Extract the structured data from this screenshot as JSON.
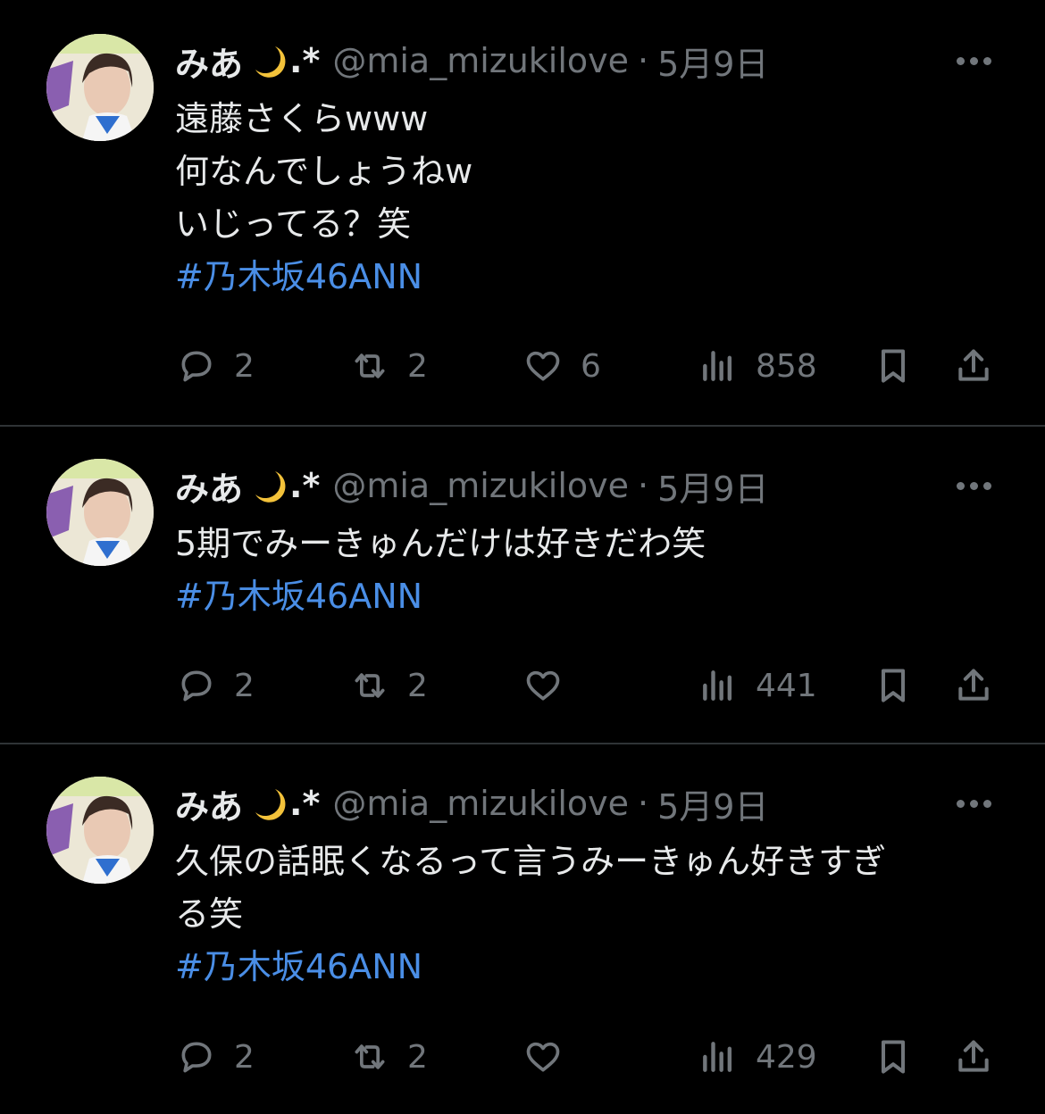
{
  "tweets": [
    {
      "author": {
        "name": "みあ",
        "suffix": ".*",
        "handle": "@mia_mizukilove",
        "separator": "·",
        "date": "5月9日"
      },
      "lines": [
        "遠藤さくらwww",
        "何なんでしょうねw",
        "いじってる？笑"
      ],
      "hashtag": "#乃木坂46ANN",
      "stats": {
        "replies": "2",
        "retweets": "2",
        "likes": "6",
        "views": "858"
      }
    },
    {
      "author": {
        "name": "みあ",
        "suffix": ".*",
        "handle": "@mia_mizukilove",
        "separator": "·",
        "date": "5月9日"
      },
      "lines": [
        "5期でみーきゅんだけは好きだわ笑"
      ],
      "hashtag": "#乃木坂46ANN",
      "stats": {
        "replies": "2",
        "retweets": "2",
        "likes": "",
        "views": "441"
      }
    },
    {
      "author": {
        "name": "みあ",
        "suffix": ".*",
        "handle": "@mia_mizukilove",
        "separator": "·",
        "date": "5月9日"
      },
      "lines": [
        "久保の話眠くなるって言うみーきゅん好きすぎ",
        "る笑"
      ],
      "hashtag": "#乃木坂46ANN",
      "stats": {
        "replies": "2",
        "retweets": "2",
        "likes": "",
        "views": "429"
      }
    }
  ],
  "colors": {
    "background": "#000000",
    "text": "#e7e9ea",
    "muted": "#71767b",
    "hashtag": "#4a8ee6",
    "divider": "#2f3336"
  },
  "icons": [
    "moon-emoji-icon",
    "more-icon",
    "reply-icon",
    "retweet-icon",
    "like-icon",
    "views-icon",
    "bookmark-icon",
    "share-icon"
  ]
}
